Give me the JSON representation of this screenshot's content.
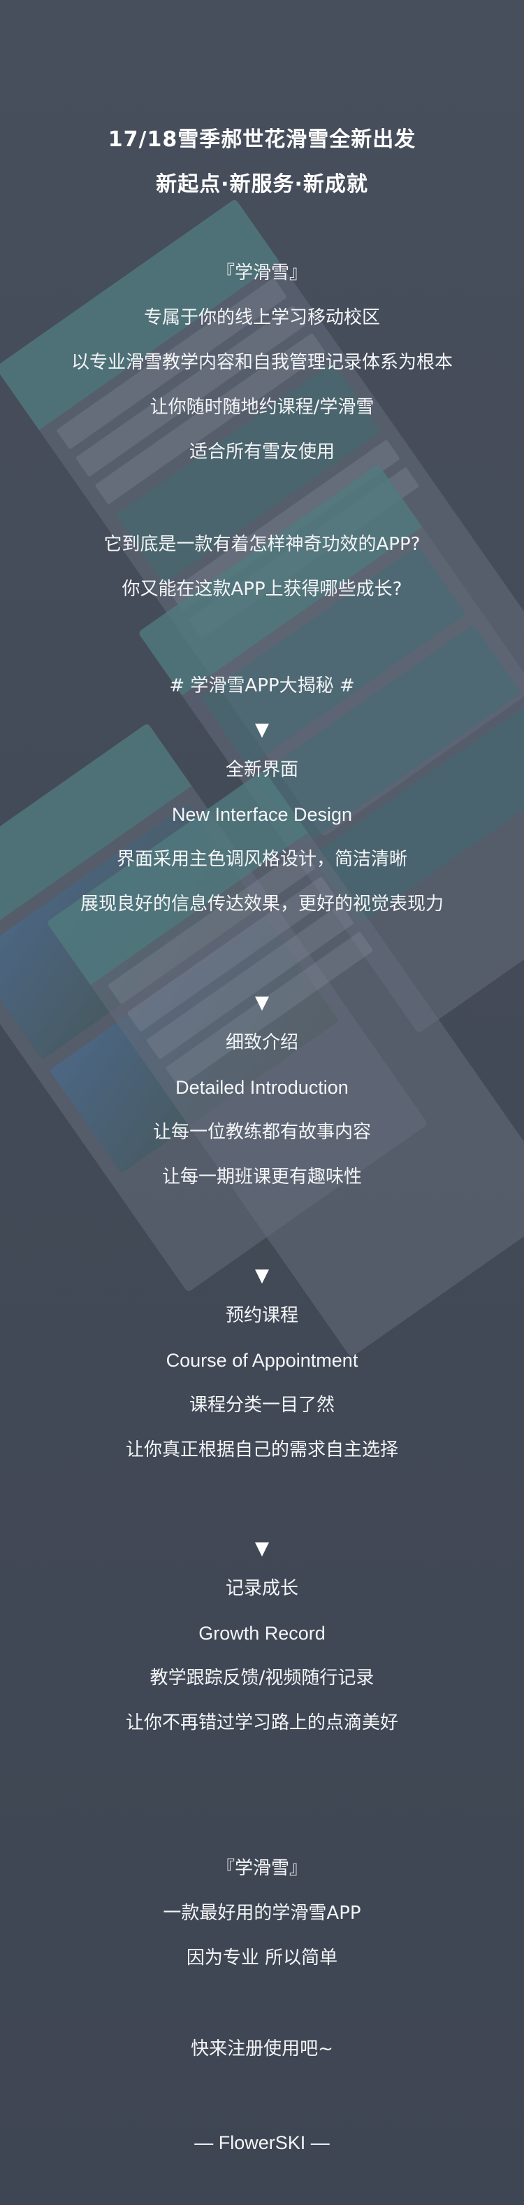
{
  "header": {
    "title_line1": "17/18雪季郝世花滑雪全新出发",
    "title_line2": "新起点·新服务·新成就"
  },
  "intro": {
    "lines": [
      "『学滑雪』",
      "专属于你的线上学习移动校区",
      "以专业滑雪教学内容和自我管理记录体系为根本",
      "让你随时随地约课程/学滑雪",
      "适合所有雪友使用"
    ]
  },
  "question": {
    "lines": [
      "它到底是一款有着怎样神奇功效的APP?",
      "你又能在这款APP上获得哪些成长?"
    ]
  },
  "reveal": {
    "heading": "# 学滑雪APP大揭秘 #",
    "arrow": "▼"
  },
  "sections": [
    {
      "title": "全新界面",
      "subtitle": "New Interface Design",
      "desc": [
        "界面采用主色调风格设计，简洁清晰",
        "展现良好的信息传达效果，更好的视觉表现力"
      ]
    },
    {
      "title": "细致介绍",
      "subtitle": "Detailed Introduction",
      "desc": [
        "让每一位教练都有故事内容",
        "让每一期班课更有趣味性"
      ]
    },
    {
      "title": "预约课程",
      "subtitle": "Course of Appointment",
      "desc": [
        "课程分类一目了然",
        "让你真正根据自己的需求自主选择"
      ]
    },
    {
      "title": "记录成长",
      "subtitle": "Growth Record",
      "desc": [
        "教学跟踪反馈/视频随行记录",
        "让你不再错过学习路上的点滴美好"
      ]
    }
  ],
  "outro": {
    "lines": [
      "『学滑雪』",
      "一款最好用的学滑雪APP",
      "因为专业 所以简单"
    ],
    "cta": "快来注册使用吧~",
    "signature": "— FlowerSKI —"
  }
}
